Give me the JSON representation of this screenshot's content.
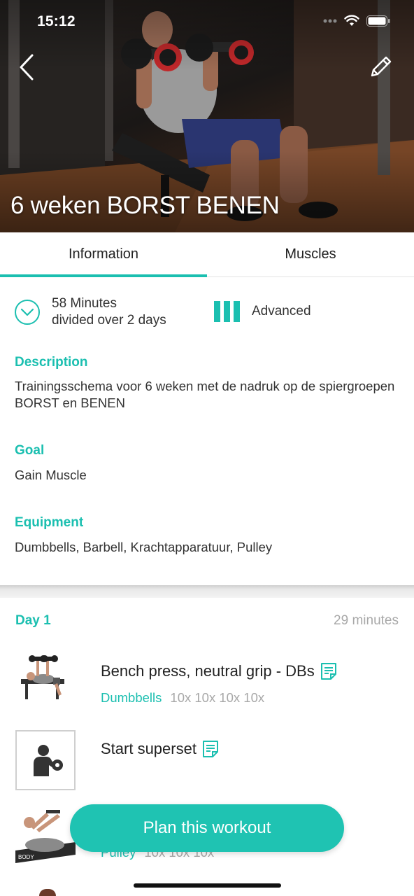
{
  "status": {
    "time": "15:12"
  },
  "header": {
    "title": "6 weken BORST BENEN",
    "back_icon": "chevron-left-icon",
    "edit_icon": "pencil-icon"
  },
  "tabs": [
    {
      "label": "Information",
      "active": true
    },
    {
      "label": "Muscles",
      "active": false
    }
  ],
  "info": {
    "duration_line1": "58 Minutes",
    "duration_line2": "divided over 2 days",
    "level": "Advanced",
    "description_heading": "Description",
    "description": "Trainingsschema voor 6 weken met de nadruk op de spiergroepen BORST en BENEN",
    "goal_heading": "Goal",
    "goal": "Gain Muscle",
    "equipment_heading": "Equipment",
    "equipment": "Dumbbells, Barbell, Krachtapparatuur, Pulley"
  },
  "day": {
    "title": "Day 1",
    "minutes": "29 minutes",
    "exercises": [
      {
        "name": "Bench press, neutral grip - DBs",
        "equipment": "Dumbbells",
        "sets": "10x 10x 10x 10x"
      },
      {
        "name": "Start superset"
      },
      {
        "name": "",
        "equipment": "Pulley",
        "sets": "10x 10x 10x"
      }
    ]
  },
  "cta": {
    "label": "Plan this workout"
  },
  "colors": {
    "accent": "#1bbfb0",
    "muted": "#a8a8a8",
    "text": "#222222"
  }
}
